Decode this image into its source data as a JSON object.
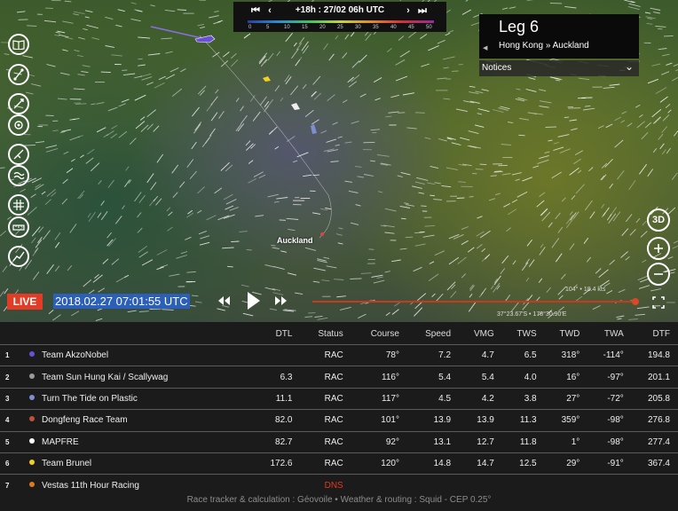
{
  "timebar": {
    "time": "+18h : 27/02 06h UTC",
    "scale": [
      "0",
      "5",
      "10",
      "15",
      "20",
      "25",
      "30",
      "35",
      "40",
      "45",
      "50"
    ]
  },
  "leg": {
    "title": "Leg 6",
    "route": "Hong Kong » Auckland",
    "arrow": "◀"
  },
  "notices": {
    "label": "Notices"
  },
  "map": {
    "city": "Auckland",
    "wind_readout": "104° • 18.4 kts",
    "coordinates": "37°23.67'S • 178°30.90'E"
  },
  "controls": {
    "live": "LIVE",
    "datetime": "2018.02.27 07:01:55 UTC",
    "view_3d": "3D"
  },
  "table": {
    "headers": [
      "",
      "DTL",
      "Status",
      "Course",
      "Speed",
      "VMG",
      "TWS",
      "TWD",
      "TWA",
      "DTF"
    ],
    "rows": [
      {
        "pos": "1",
        "name": "Team AkzoNobel",
        "color": "#6b4fd8",
        "dtl": "",
        "status": "RAC",
        "course": "78°",
        "speed": "7.2",
        "vmg": "4.7",
        "tws": "6.5",
        "twd": "318°",
        "twa": "-114°",
        "dtf": "194.8"
      },
      {
        "pos": "2",
        "name": "Team Sun Hung Kai / Scallywag",
        "color": "#9a9a9a",
        "dtl": "6.3",
        "status": "RAC",
        "course": "116°",
        "speed": "5.4",
        "vmg": "5.4",
        "tws": "4.0",
        "twd": "16°",
        "twa": "-97°",
        "dtf": "201.1"
      },
      {
        "pos": "3",
        "name": "Turn The Tide on Plastic",
        "color": "#7d8fd0",
        "dtl": "11.1",
        "status": "RAC",
        "course": "117°",
        "speed": "4.5",
        "vmg": "4.2",
        "tws": "3.8",
        "twd": "27°",
        "twa": "-72°",
        "dtf": "205.8"
      },
      {
        "pos": "4",
        "name": "Dongfeng Race Team",
        "color": "#c0503a",
        "dtl": "82.0",
        "status": "RAC",
        "course": "101°",
        "speed": "13.9",
        "vmg": "13.9",
        "tws": "11.3",
        "twd": "359°",
        "twa": "-98°",
        "dtf": "276.8"
      },
      {
        "pos": "5",
        "name": "MAPFRE",
        "color": "#ffffff",
        "dtl": "82.7",
        "status": "RAC",
        "course": "92°",
        "speed": "13.1",
        "vmg": "12.7",
        "tws": "11.8",
        "twd": "1°",
        "twa": "-98°",
        "dtf": "277.4"
      },
      {
        "pos": "6",
        "name": "Team Brunel",
        "color": "#f2d020",
        "dtl": "172.6",
        "status": "RAC",
        "course": "120°",
        "speed": "14.8",
        "vmg": "14.7",
        "tws": "12.5",
        "twd": "29°",
        "twa": "-91°",
        "dtf": "367.4"
      },
      {
        "pos": "7",
        "name": "Vestas 11th Hour Racing",
        "color": "#e07a1a",
        "dtl": "",
        "status": "DNS",
        "course": "",
        "speed": "",
        "vmg": "",
        "tws": "",
        "twd": "",
        "twa": "",
        "dtf": ""
      }
    ]
  },
  "footer": "Race tracker & calculation : Géovoile • Weather & routing : Squid - CEP 0.25°",
  "colors": {
    "live": "#e23b26",
    "dns": "#e03a20",
    "slider": "#c83a20",
    "datetime_bg": "#2c5fb8"
  }
}
